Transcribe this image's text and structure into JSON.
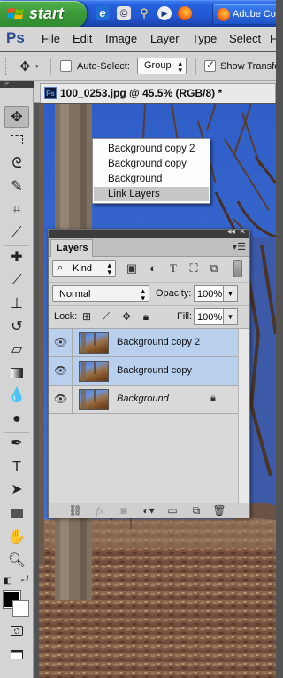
{
  "taskbar": {
    "start_label": "start",
    "task_button_label": "Adobe Co"
  },
  "menubar": {
    "app_logo": "Ps",
    "items": [
      "File",
      "Edit",
      "Image",
      "Layer",
      "Type",
      "Select",
      "F"
    ]
  },
  "options_bar": {
    "auto_select_label": "Auto-Select:",
    "auto_select_checked": false,
    "target_value": "Group",
    "show_transform_label": "Show Transform",
    "show_transform_checked": true
  },
  "document": {
    "tab_title": "100_0253.jpg @ 45.5% (RGB/8) *"
  },
  "context_menu": {
    "items": [
      {
        "label": "Background copy 2",
        "highlighted": false
      },
      {
        "label": "Background copy",
        "highlighted": false
      },
      {
        "label": "Background",
        "highlighted": false
      },
      {
        "label": "Link Layers",
        "highlighted": true
      }
    ]
  },
  "layers_panel": {
    "tab_label": "Layers",
    "filter_kind": "Kind",
    "blend_mode": "Normal",
    "opacity_label": "Opacity:",
    "opacity_value": "100%",
    "lock_label": "Lock:",
    "fill_label": "Fill:",
    "fill_value": "100%",
    "layers": [
      {
        "name": "Background copy 2",
        "selected": true,
        "italic": false,
        "locked": false,
        "visible": true
      },
      {
        "name": "Background copy",
        "selected": true,
        "italic": false,
        "locked": false,
        "visible": true
      },
      {
        "name": "Background",
        "selected": false,
        "italic": true,
        "locked": true,
        "visible": true
      }
    ]
  },
  "colors": {
    "foreground": "#000000",
    "background": "#ffffff",
    "layer_selected": "#b8cfee",
    "menu_highlight": "#c7c7c7"
  }
}
